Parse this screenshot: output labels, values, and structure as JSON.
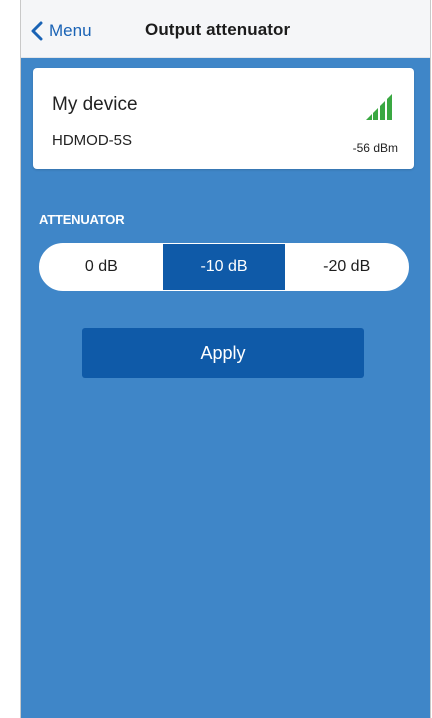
{
  "navbar": {
    "back_label": "Menu",
    "title": "Output attenuator"
  },
  "device": {
    "name": "My device",
    "model": "HDMOD-5S",
    "signal": "-56 dBm",
    "signal_icon": "signal-strength-icon",
    "signal_color": "#3aa842"
  },
  "attenuator": {
    "label": "ATTENUATOR",
    "options": [
      "0 dB",
      "-10 dB",
      "-20 dB"
    ],
    "selected": "-10 dB"
  },
  "apply_label": "Apply",
  "colors": {
    "background": "#3f86c8",
    "accent": "#0f5aa8",
    "link": "#1a63b5"
  }
}
